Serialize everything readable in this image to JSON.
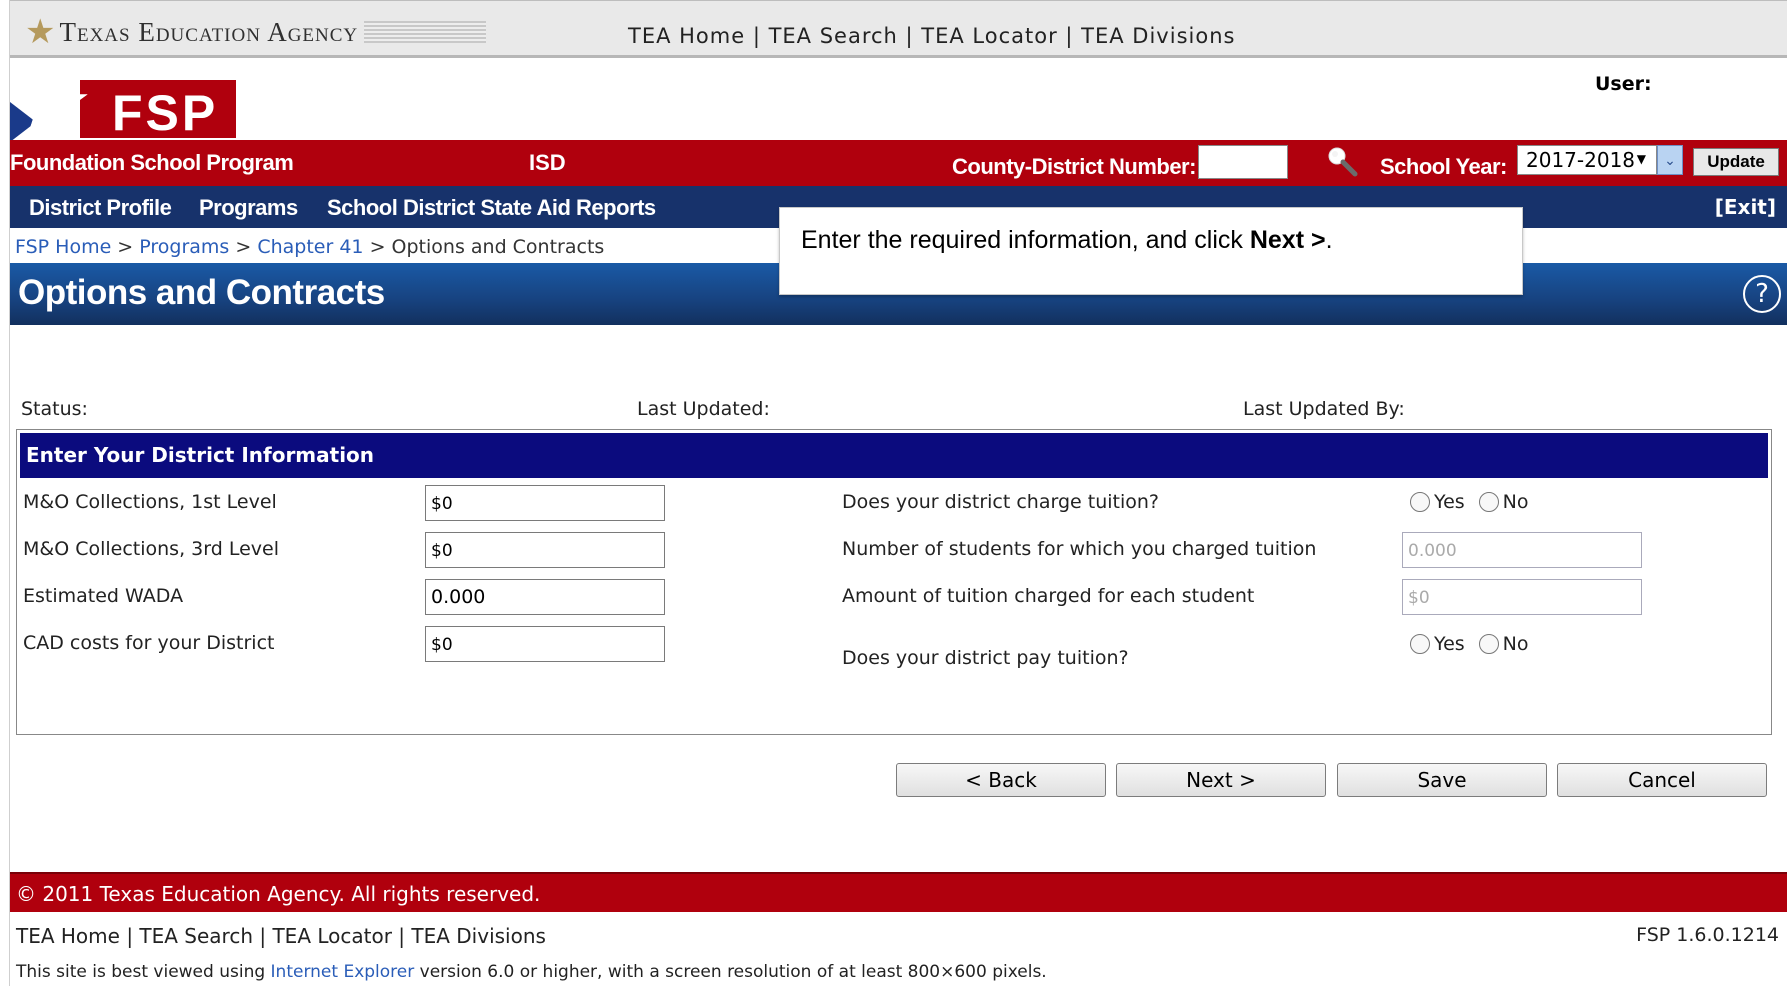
{
  "tea_bar": {
    "logo_text": "Texas Education Agency",
    "links": "TEA Home | TEA Search | TEA Locator | TEA Divisions"
  },
  "logo": {
    "text": "FSP"
  },
  "user": {
    "label": "User:"
  },
  "header": {
    "program_title": "Foundation School Program",
    "isd": "ISD",
    "county_district_label": "County-District Number:",
    "county_district_value": "",
    "school_year_label": "School Year:",
    "school_year_value": "2017-2018",
    "update_label": "Update"
  },
  "nav": {
    "items": [
      "District Profile",
      "Programs",
      "School District State Aid Reports"
    ],
    "exit": "[Exit]"
  },
  "breadcrumb": {
    "items": [
      "FSP Home",
      "Programs",
      "Chapter 41"
    ],
    "current": "Options and Contracts",
    "separator": " > "
  },
  "page": {
    "title": "Options and Contracts",
    "help": "?"
  },
  "callout": {
    "text_before": "Enter the required information, and click ",
    "bold": "Next >",
    "text_after": "."
  },
  "status": {
    "status_label": "Status:",
    "last_updated_label": "Last Updated:",
    "last_updated_by_label": "Last Updated By:"
  },
  "panel": {
    "header": "Enter Your District Information",
    "left_fields": [
      {
        "label": "M&O Collections, 1st Level",
        "value": "$0"
      },
      {
        "label": "M&O Collections, 3rd Level",
        "value": "$0"
      },
      {
        "label": "Estimated WADA",
        "value": "0.000"
      },
      {
        "label": "CAD costs for your District",
        "value": "$0"
      }
    ],
    "right_fields": [
      {
        "label": "Does your district charge tuition?",
        "yes": "Yes",
        "no": "No"
      },
      {
        "label": "Number of students for which you charged tuition",
        "value": "0.000"
      },
      {
        "label": "Amount of tuition charged for each student",
        "value": "$0"
      },
      {
        "label": "Does your district pay tuition?",
        "yes": "Yes",
        "no": "No"
      }
    ]
  },
  "buttons": {
    "back": "< Back",
    "next": "Next >",
    "save": "Save",
    "cancel": "Cancel"
  },
  "footer": {
    "copyright": "© 2011 Texas Education Agency. All rights reserved.",
    "links": "TEA Home | TEA Search | TEA Locator | TEA Divisions",
    "version": "FSP 1.6.0.1214",
    "note_before": "This site is best viewed using ",
    "note_link": "Internet Explorer",
    "note_after": " version 6.0 or higher, with a screen resolution of at least 800×600 pixels."
  }
}
